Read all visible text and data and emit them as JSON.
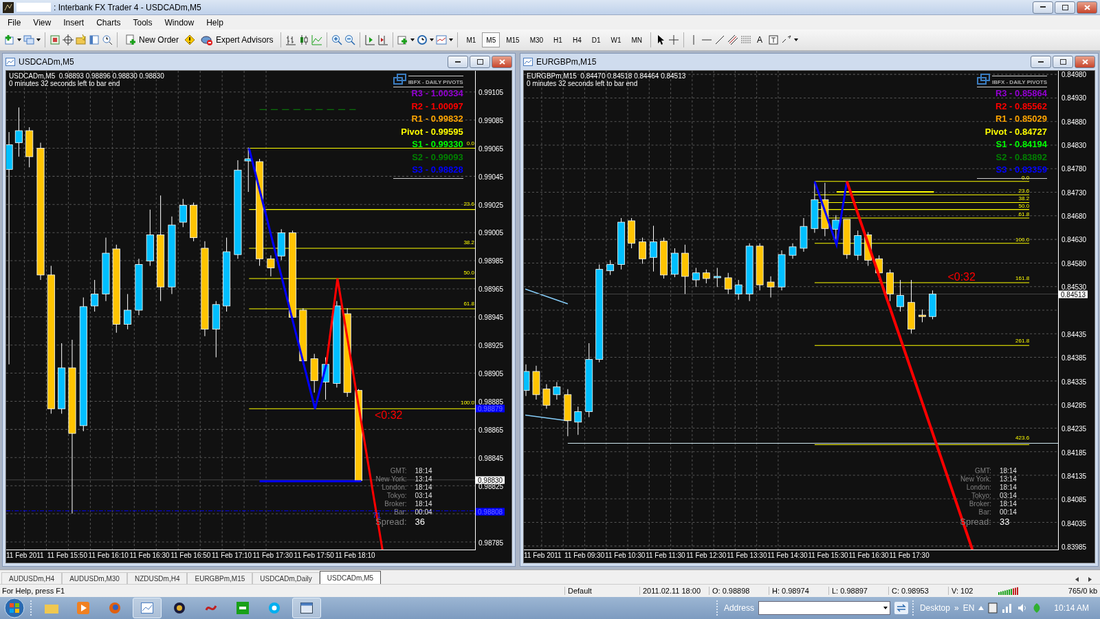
{
  "window": {
    "title": ": Interbank FX Trader 4 - USDCADm,M5"
  },
  "menu": [
    "File",
    "View",
    "Insert",
    "Charts",
    "Tools",
    "Window",
    "Help"
  ],
  "toolbar": {
    "new_order": "New Order",
    "expert_advisors": "Expert Advisors",
    "text_tool": "A",
    "periods": [
      {
        "label": "M1",
        "selected": false
      },
      {
        "label": "M5",
        "selected": true
      },
      {
        "label": "M15",
        "selected": false
      },
      {
        "label": "M30",
        "selected": false
      },
      {
        "label": "H1",
        "selected": false
      },
      {
        "label": "H4",
        "selected": false
      },
      {
        "label": "D1",
        "selected": false
      },
      {
        "label": "W1",
        "selected": false
      },
      {
        "label": "MN",
        "selected": false
      }
    ]
  },
  "charts": [
    {
      "title": "USDCADm,M5",
      "info": "USDCADm,M5  0.98893 0.98896 0.98830 0.98830",
      "timer": "0 minutes 32 seconds left to bar end",
      "pivots_title": "IBFX - DAILY PIVOTS",
      "pivots": [
        {
          "label": "R3 - 1.00334",
          "color": "#9400d3"
        },
        {
          "label": "R2 - 1.00097",
          "color": "#ff0000"
        },
        {
          "label": "R1 - 0.99832",
          "color": "#ffa500"
        },
        {
          "label": "Pivot - 0.99595",
          "color": "#ffff00"
        },
        {
          "label": "S1 - 0.99330",
          "color": "#00ff00"
        },
        {
          "label": "S2 - 0.99093",
          "color": "#008000"
        },
        {
          "label": "S3 - 0.98828",
          "color": "#0000ff"
        }
      ],
      "fib_labels": [
        "0.0",
        "23.6",
        "38.2",
        "50.0",
        "61.8",
        "100.0"
      ],
      "countdown": "<0:32",
      "marker_label": "71",
      "clock": [
        {
          "label": "GMT:",
          "value": "18:14"
        },
        {
          "label": "New York:",
          "value": "13:14"
        },
        {
          "label": "London:",
          "value": "18:14"
        },
        {
          "label": "Tokyo:",
          "value": "03:14"
        },
        {
          "label": "Broker:",
          "value": "18:14"
        },
        {
          "label": "Bar:",
          "value": "00:04"
        }
      ],
      "spread": {
        "label": "Spread:",
        "value": "36"
      },
      "price_ticks": [
        "0.99105",
        "0.99085",
        "0.99065",
        "0.99045",
        "0.99025",
        "0.99005",
        "0.98985",
        "0.98965",
        "0.98945",
        "0.98925",
        "0.98905",
        "0.98885",
        "0.98865",
        "0.98845",
        "0.98825",
        "0.98785"
      ],
      "price_badges": [
        {
          "text": "0.98879",
          "kind": "line"
        },
        {
          "text": "0.98830",
          "kind": "current"
        },
        {
          "text": "0.98808",
          "kind": "line"
        }
      ],
      "time_ticks": [
        "11 Feb 2011",
        "11 Feb 15:50",
        "11 Feb 16:10",
        "11 Feb 16:30",
        "11 Feb 16:50",
        "11 Feb 17:10",
        "11 Feb 17:30",
        "11 Feb 17:50",
        "11 Feb 18:10"
      ]
    },
    {
      "title": "EURGBPm,M15",
      "info": "EURGBPm,M15  0.84470 0.84518 0.84464 0.84513",
      "timer": "0 minutes 32 seconds left to bar end",
      "pivots_title": "IBFX - DAILY PIVOTS",
      "pivots": [
        {
          "label": "R3 - 0.85864",
          "color": "#9400d3"
        },
        {
          "label": "R2 - 0.85562",
          "color": "#ff0000"
        },
        {
          "label": "R1 - 0.85029",
          "color": "#ffa500"
        },
        {
          "label": "Pivot - 0.84727",
          "color": "#ffff00"
        },
        {
          "label": "S1 - 0.84194",
          "color": "#00ff00"
        },
        {
          "label": "S2 - 0.83892",
          "color": "#008000"
        },
        {
          "label": "S3 - 0.83359",
          "color": "#0000ff"
        }
      ],
      "fib_labels": [
        "0.0",
        "23.6",
        "38.2",
        "50.0",
        "61.8",
        "100.0",
        "161.8",
        "261.8",
        "423.6"
      ],
      "countdown": "<0:32",
      "clock": [
        {
          "label": "GMT:",
          "value": "18:14"
        },
        {
          "label": "New York:",
          "value": "13:14"
        },
        {
          "label": "London:",
          "value": "18:14"
        },
        {
          "label": "Tokyo:",
          "value": "03:14"
        },
        {
          "label": "Broker:",
          "value": "18:14"
        },
        {
          "label": "Bar:",
          "value": "00:14"
        }
      ],
      "spread": {
        "label": "Spread:",
        "value": "33"
      },
      "price_ticks": [
        "0.84980",
        "0.84930",
        "0.84880",
        "0.84830",
        "0.84780",
        "0.84730",
        "0.84680",
        "0.84630",
        "0.84580",
        "0.84530",
        "0.84435",
        "0.84385",
        "0.84335",
        "0.84285",
        "0.84235",
        "0.84185",
        "0.84135",
        "0.84085",
        "0.84035",
        "0.83985"
      ],
      "price_badges": [
        {
          "text": "0.84513",
          "kind": "current"
        }
      ],
      "time_ticks": [
        "11 Feb 2011",
        "11 Feb 09:30",
        "11 Feb 10:30",
        "11 Feb 11:30",
        "11 Feb 12:30",
        "11 Feb 13:30",
        "11 Feb 14:30",
        "11 Feb 15:30",
        "11 Feb 16:30",
        "11 Feb 17:30"
      ]
    }
  ],
  "chart_tabs": [
    {
      "label": "AUDUSDm,H4",
      "selected": false
    },
    {
      "label": "AUDUSDm,M30",
      "selected": false
    },
    {
      "label": "NZDUSDm,H4",
      "selected": false
    },
    {
      "label": "EURGBPm,M15",
      "selected": false
    },
    {
      "label": "USDCADm,Daily",
      "selected": false
    },
    {
      "label": "USDCADm,M5",
      "selected": true
    }
  ],
  "status_bar": {
    "help": "For Help, press F1",
    "profile": "Default",
    "time": "2011.02.11 18:00",
    "open": "O: 0.98898",
    "high": "H: 0.98974",
    "low": "L: 0.98897",
    "close": "C: 0.98953",
    "volume": "V: 102",
    "traffic": "765/0 kb"
  },
  "taskbar": {
    "address_label": "Address",
    "desktop": "Desktop",
    "chevron": "»",
    "language": "EN",
    "clock": "10:14 AM"
  }
}
